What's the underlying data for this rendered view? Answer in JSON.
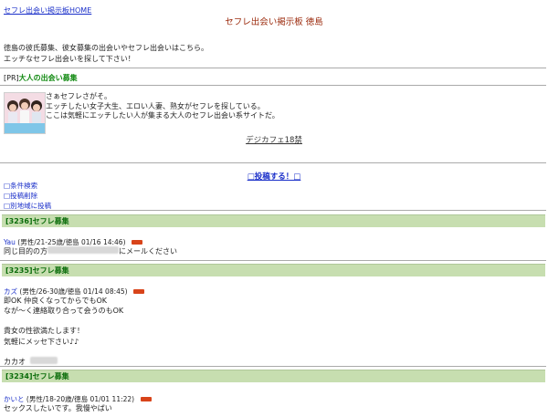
{
  "header": {
    "home_link": "セフレ出会い掲示板HOME",
    "title": "セフレ出会い掲示板 徳島"
  },
  "intro": {
    "line1": "徳島の彼氏募集、彼女募集の出会いやセフレ出会いはこちら。",
    "line2": "エッチなセフレ出会いを探して下さい！"
  },
  "pr": {
    "prefix": "[PR]",
    "title": "大人の出会い募集",
    "line1": "さぁセフレさがそ。",
    "line2": "エッチしたい女子大生、エロい人妻、熟女がセフレを探している。",
    "line3": "ここは気軽にエッチしたい人が集まる大人のセフレ出会い系サイトだ。",
    "link": "デジカフェ18禁"
  },
  "actions": {
    "post": "□投稿する！□",
    "search": "□条件検索",
    "delete": "□投稿削除",
    "other_region": "□別地域に投稿"
  },
  "posts": [
    {
      "header": "[3236]セフレ募集",
      "name": "Yau",
      "gender": "(男性",
      "info": "/21-25歳/徳島 01/16 14:46)",
      "line1_a": "同じ目的の方",
      "line1_b": "にメールください"
    },
    {
      "header": "[3235]セフレ募集",
      "name": "カズ",
      "gender": "(男性",
      "info": "/26-30歳/徳島 01/14 08:45)",
      "line1": "即OK 仲良くなってからでもOK",
      "line2": "なが～く連絡取り合って会うのもOK",
      "line3": "貴女の性欲満たします！",
      "line4": "気軽にメッセ下さい♪♪",
      "line5": "カカオ"
    },
    {
      "header": "[3234]セフレ募集",
      "name": "かいと",
      "gender": "(男性",
      "info": "/18-20歳/徳島 01/01 11:22)",
      "line1": "セックスしたいです。我慢やばい"
    }
  ],
  "colors": {
    "link": "#1a2fc9",
    "title": "#9b2a0c",
    "pr_title": "#118a11",
    "bar_bg": "#c7deb0",
    "bar_text": "#0b6d0b",
    "mail_badge": "#d8441a"
  }
}
